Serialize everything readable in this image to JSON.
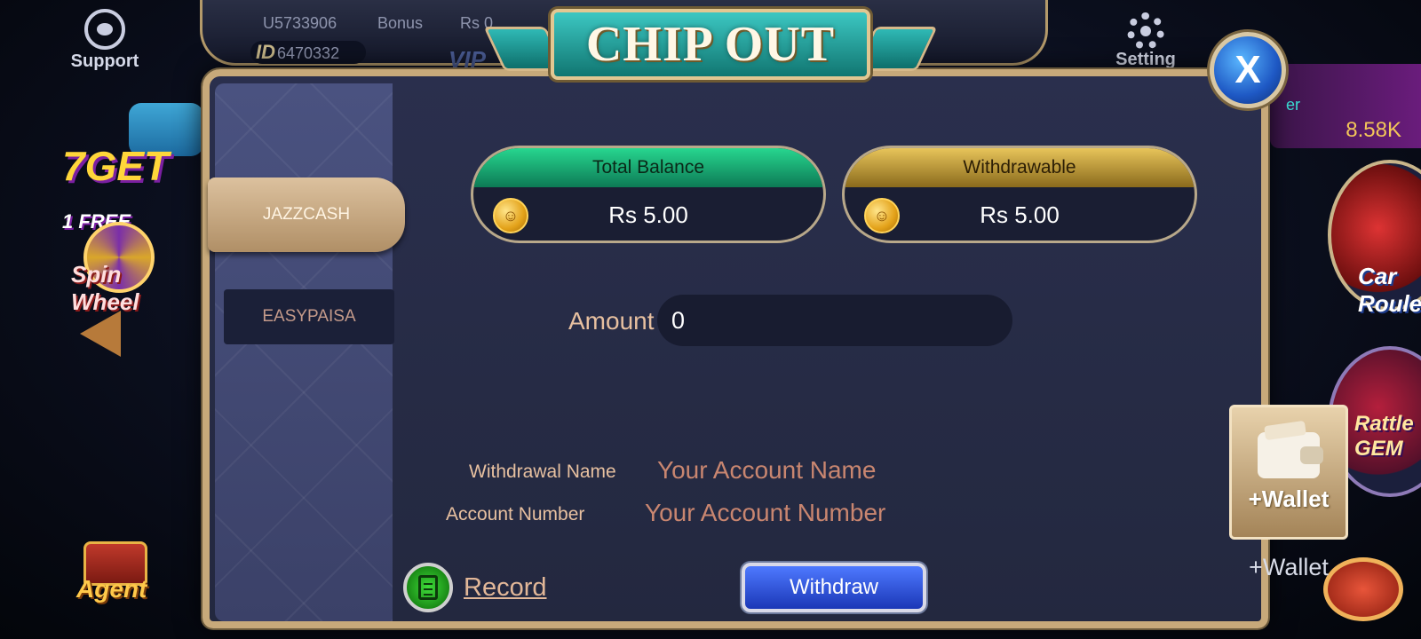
{
  "lobby": {
    "support_label": "Support",
    "user_code": "U5733906",
    "id_prefix": "ID",
    "id_value": "6470332",
    "bonus_label": "Bonus",
    "bonus_value": "Rs 0",
    "vip_label": "VIP",
    "setting_label": "Setting",
    "promo_7get": "7GET",
    "promo_free": "1 FREE",
    "spin_wheel_label": "Spin Wheel",
    "agent_label": "Agent",
    "right_card_value": "8.58K",
    "right_card_text": "er",
    "game_car_label": "Car Roule",
    "game_rattle_label": "Rattle GEM"
  },
  "dialog": {
    "title": "CHIP OUT",
    "close_label": "X",
    "payment_methods": [
      {
        "label": "JAZZCASH",
        "selected": true
      },
      {
        "label": "EASYPAISA",
        "selected": false
      }
    ],
    "total_balance": {
      "label": "Total Balance",
      "value": "Rs 5.00"
    },
    "withdrawable": {
      "label": "Withdrawable",
      "value": "Rs 5.00"
    },
    "amount": {
      "label": "Amount",
      "value": "0"
    },
    "withdrawal_name": {
      "label": "Withdrawal Name",
      "placeholder": "Your Account Name"
    },
    "account_number": {
      "label": "Account Number",
      "placeholder": "Your Account Number"
    },
    "record_label": "Record",
    "withdraw_label": "Withdraw",
    "wallet_button_label": "+Wallet",
    "wallet_caption": "+Wallet"
  },
  "colors": {
    "accent_green": "#27d68f",
    "accent_gold": "#e7c45a",
    "frame_gold": "#c7a97a",
    "withdraw_blue": "#2b50e0",
    "panel_bg": "#262b46"
  }
}
